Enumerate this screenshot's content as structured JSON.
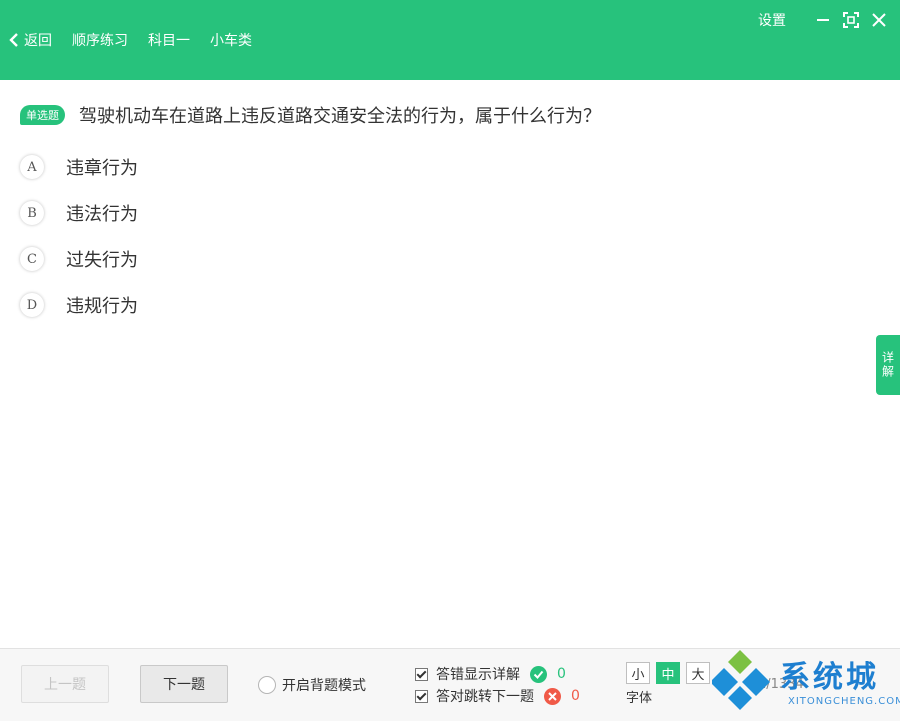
{
  "header": {
    "back_label": "返回",
    "crumbs": [
      "顺序练习",
      "科目一",
      "小车类"
    ],
    "settings_label": "设置"
  },
  "question": {
    "type_badge": "单选题",
    "text": "驾驶机动车在道路上违反道路交通安全法的行为，属于什么行为？",
    "options": [
      {
        "letter": "A",
        "text": "违章行为"
      },
      {
        "letter": "B",
        "text": "违法行为"
      },
      {
        "letter": "C",
        "text": "过失行为"
      },
      {
        "letter": "D",
        "text": "违规行为"
      }
    ]
  },
  "side_tab": {
    "label": "详解"
  },
  "footer": {
    "prev_label": "上一题",
    "next_label": "下一题",
    "memorize_label": "开启背题模式",
    "show_detail_label": "答错显示详解",
    "auto_next_label": "答对跳转下一题",
    "correct_count": "0",
    "wrong_count": "0",
    "font_sizes": [
      "小",
      "中",
      "大"
    ],
    "font_active": "中",
    "font_label": "字体",
    "question_count": "1/1334"
  },
  "watermark": {
    "text": "系统城",
    "sub": "XITONGCHENG.COM"
  },
  "colors": {
    "accent": "#27c27c",
    "wrong": "#f05a48",
    "watermark": "#1e7fd0"
  }
}
